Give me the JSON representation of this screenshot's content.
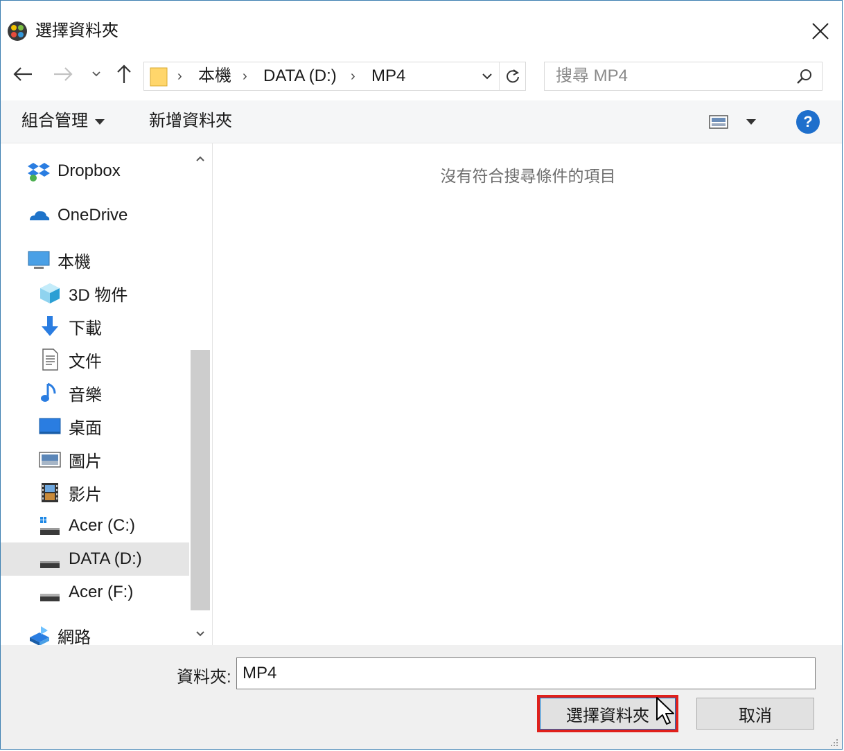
{
  "window": {
    "title": "選擇資料夾",
    "close_label": "✕"
  },
  "address": {
    "crumbs": [
      "本機",
      "DATA (D:)",
      "MP4"
    ],
    "separator": "›"
  },
  "search": {
    "placeholder": "搜尋 MP4"
  },
  "commands": {
    "organize": "組合管理",
    "new_folder": "新增資料夾",
    "help": "?"
  },
  "nav": {
    "items": [
      {
        "label": "Dropbox",
        "icon": "dropbox-icon"
      },
      {
        "label": "OneDrive",
        "icon": "onedrive-icon"
      },
      {
        "label": "本機",
        "icon": "this-pc-icon"
      },
      {
        "label": "3D 物件",
        "icon": "3d-objects-icon"
      },
      {
        "label": "下載",
        "icon": "downloads-icon"
      },
      {
        "label": "文件",
        "icon": "documents-icon"
      },
      {
        "label": "音樂",
        "icon": "music-icon"
      },
      {
        "label": "桌面",
        "icon": "desktop-icon"
      },
      {
        "label": "圖片",
        "icon": "pictures-icon"
      },
      {
        "label": "影片",
        "icon": "videos-icon"
      },
      {
        "label": "Acer (C:)",
        "icon": "drive-c-icon"
      },
      {
        "label": "DATA (D:)",
        "icon": "drive-d-icon",
        "selected": true
      },
      {
        "label": "Acer (F:)",
        "icon": "drive-f-icon"
      },
      {
        "label": "網路",
        "icon": "network-icon"
      }
    ]
  },
  "content": {
    "empty_message": "沒有符合搜尋條件的項目"
  },
  "footer": {
    "folder_label": "資料夾:",
    "folder_value": "MP4",
    "select_button": "選擇資料夾",
    "cancel_button": "取消"
  },
  "colors": {
    "accent": "#0078d7",
    "highlight_box": "#e0201b",
    "help_blue": "#1e6fcc",
    "selected_bg": "#e5e5e5"
  }
}
